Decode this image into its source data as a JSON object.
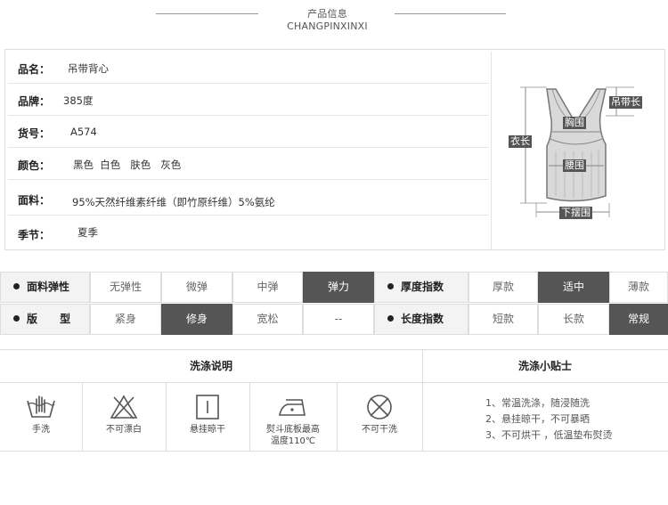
{
  "header": {
    "title": "产品信息CHANGPINXINXI"
  },
  "info": {
    "rows": [
      {
        "key": "品名：",
        "value": "吊带背心"
      },
      {
        "key": "品牌：",
        "value": "385度"
      },
      {
        "key": "货号：",
        "value": "A574"
      },
      {
        "key": "颜色：",
        "value": "黑色  白色   肤色   灰色"
      },
      {
        "key": "面料：",
        "value": "95%天然纤维素纤维（即竹原纤维）5%氨纶"
      },
      {
        "key": "季节：",
        "value": "夏季"
      }
    ]
  },
  "diagram": {
    "labels": {
      "strap": "吊带长",
      "chest": "胸围",
      "length": "衣长",
      "waist": "腰围",
      "hem": "下摆围"
    }
  },
  "attributes": {
    "elasticity": {
      "label": "面料弹性",
      "options": [
        "无弹性",
        "微弹",
        "中弹",
        "弹力"
      ],
      "selected": "弹力"
    },
    "thickness": {
      "label": "厚度指数",
      "options": [
        "厚款",
        "适中",
        "薄款"
      ],
      "selected": "适中"
    },
    "fit": {
      "label": "版      型",
      "options": [
        "紧身",
        "修身",
        "宽松",
        "--"
      ],
      "selected": "修身"
    },
    "length": {
      "label": "长度指数",
      "options": [
        "短款",
        "长款",
        "常规"
      ],
      "selected": "常规"
    }
  },
  "wash": {
    "title": "洗涤说明",
    "icons": [
      {
        "icon": "hand-wash-icon",
        "label": "手洗"
      },
      {
        "icon": "no-bleach-icon",
        "label": "不可漂白"
      },
      {
        "icon": "hang-dry-icon",
        "label": "悬挂晾干"
      },
      {
        "icon": "iron-icon",
        "label1": "熨斗底板最高",
        "label2": "温度110℃"
      },
      {
        "icon": "no-dry-clean-icon",
        "label": "不可干洗"
      }
    ]
  },
  "tips": {
    "title": "洗涤小贴士",
    "lines": [
      "1、常温洗涤，随浸随洗",
      "2、悬挂晾干，不可暴晒",
      "3、不可烘干 ，低温垫布熨烫"
    ]
  }
}
